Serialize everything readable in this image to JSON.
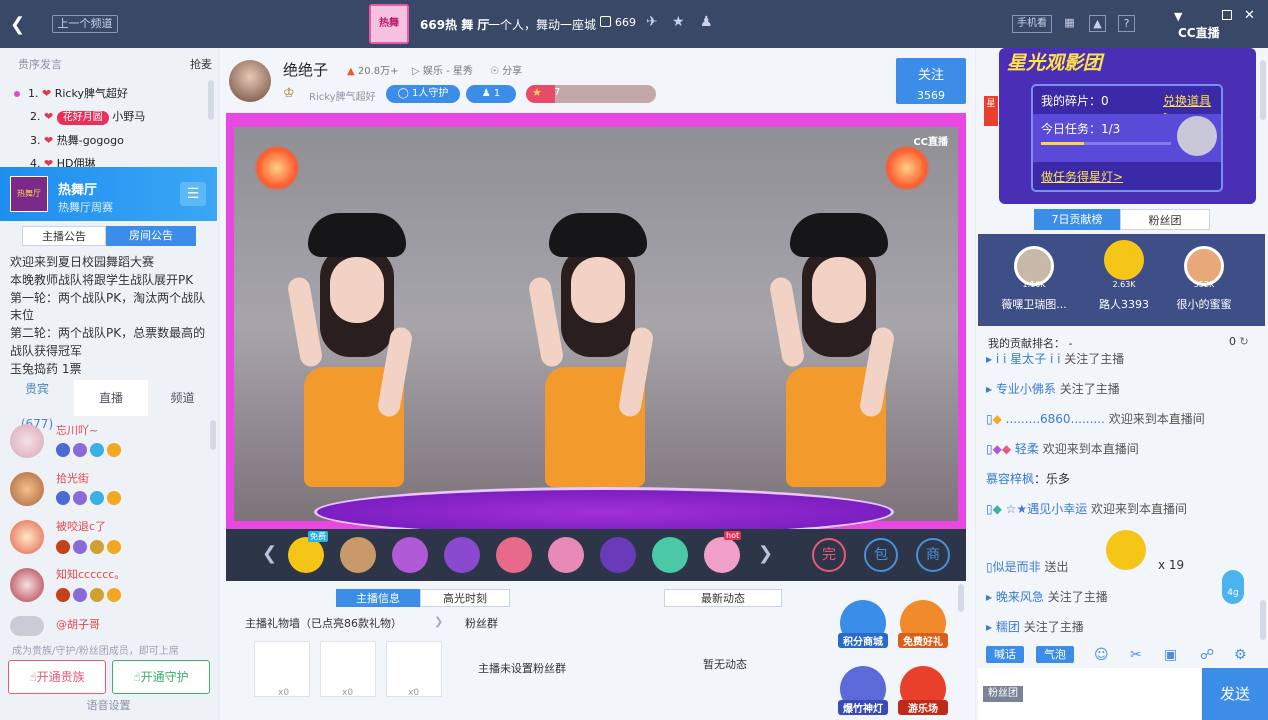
{
  "topbar": {
    "back_icon": "chevron-left-icon",
    "prev_channel": "上一个频道",
    "logo_text": "热舞",
    "title": "669热 舞 厅",
    "tagline": "一个人，舞动一座城",
    "room_id": "669",
    "phone_watch": "手机看",
    "help": "?",
    "cc_logo": "CC直播"
  },
  "left": {
    "rank_header": "贵序发言",
    "rank_action": "抢麦",
    "rank_items": [
      {
        "num": "1.",
        "name": "Ricky脾气超好"
      },
      {
        "num": "2.",
        "badge": "花好月圆",
        "name": "小野马"
      },
      {
        "num": "3.",
        "name": "热舞-gogogo"
      },
      {
        "num": "4.",
        "name": "HD佣琳"
      }
    ],
    "channel": {
      "thumb": "热舞厅",
      "name": "热舞厅",
      "sub": "热舞厅周赛"
    },
    "notice_tabs": [
      "主播公告",
      "房间公告"
    ],
    "notice_lines": [
      "欢迎来到夏日校园舞蹈大赛",
      "本晚教师战队将跟学生战队展开PK",
      "第一轮：两个战队PK，淘汰两个战队",
      "末位",
      "第二轮：两个战队PK，总票数最高的",
      "战队获得冠军",
      "玉兔捣药 1票"
    ],
    "user_tabs": [
      {
        "label": "贵宾",
        "count": "(677)"
      },
      {
        "label": "直播"
      },
      {
        "label": "频道"
      }
    ],
    "users": [
      {
        "name": "忘川吖~"
      },
      {
        "name": "拾光街"
      },
      {
        "name": "被咬退c了"
      },
      {
        "name": "知知cccccc。"
      },
      {
        "name": "@胡子哥"
      }
    ],
    "footer_hint": "成为贵族/守护/粉丝团成员，即可上席",
    "btn_noble": "开通贵族",
    "btn_guard": "开通守护",
    "voice_settings": "语音设置"
  },
  "host": {
    "name": "绝绝子",
    "heat": "20.8万+",
    "category": "娱乐 - 星秀",
    "share": "分享",
    "sub_name": "Ricky脾气超好",
    "guard": "1人守护",
    "fans": "1",
    "level": "7",
    "level_progress": 0.22,
    "follow_label": "关注",
    "follow_count": "3569"
  },
  "video": {
    "watermark": "CC直播"
  },
  "gifts": {
    "items": [
      {
        "icon": "duck-gift-icon",
        "tag": "免费",
        "color": "#f5c518"
      },
      {
        "icon": "lion-gift-icon",
        "color": "#c89a6a"
      },
      {
        "icon": "character-gift-icon",
        "color": "#b05ad8"
      },
      {
        "icon": "fairy-gift-icon",
        "color": "#8a4ad0"
      },
      {
        "icon": "cake-gift-icon",
        "color": "#e86a8a"
      },
      {
        "icon": "pony-gift-icon",
        "color": "#e88ab8"
      },
      {
        "icon": "crown-gift-icon",
        "color": "#6a3ab8"
      },
      {
        "icon": "drink-gift-icon",
        "color": "#4ac8a8"
      },
      {
        "icon": "icecream-gift-icon",
        "tag": "hot",
        "color": "#f0a0c8"
      }
    ],
    "actions": [
      "完",
      "包",
      "商"
    ]
  },
  "info": {
    "tabs": [
      "主播信息",
      "高光时刻"
    ],
    "dynamics_tab": "最新动态",
    "gift_wall": "主播礼物墙（已点亮86款礼物）",
    "fan_group": "粉丝群",
    "no_fan_group": "主播未设置粉丝群",
    "no_dynamics": "暂无动态",
    "wall_counts": [
      "x0",
      "x0",
      "x0"
    ],
    "actions": [
      {
        "label": "积分商城",
        "color": "#3a8de8"
      },
      {
        "label": "免费好礼",
        "color": "#f08a2a"
      },
      {
        "label": "爆竹神灯",
        "color": "#5a6ad8"
      },
      {
        "label": "游乐场",
        "color": "#e8402a"
      }
    ]
  },
  "promo": {
    "title": "星光观影团",
    "fragments": "我的碎片：0",
    "redeem": "兑换道具>",
    "task": "今日任务：1/3",
    "task_progress": 0.33,
    "do_task": "做任务得星灯>"
  },
  "contrib": {
    "tabs": [
      "7日贡献榜",
      "粉丝团"
    ],
    "top": [
      {
        "value": "1.10K",
        "name": "薇嘿卫瑞图..."
      },
      {
        "value": "2.63K",
        "name": "路人3393"
      },
      {
        "value": "352K",
        "name": "很小的蜜蜜"
      }
    ],
    "my_rank_label": "我的贡献排名：",
    "my_rank_value": "-",
    "my_value": "0"
  },
  "chat": {
    "lines": [
      {
        "user": " i i 星太子 i i",
        "msg": "关注了主播"
      },
      {
        "user": "专业小佛系",
        "msg": "关注了主播"
      },
      {
        "user": ".........6860.........",
        "msg": "欢迎来到本直播间"
      },
      {
        "user": "轻柔",
        "msg": "欢迎来到本直播间"
      },
      {
        "user": "慕容梓枫",
        "msg": "：乐多"
      },
      {
        "user": "☆★遇见小幸运",
        "msg": "欢迎来到本直播间"
      },
      {
        "user": "似是而非",
        "msg": "送出",
        "count": "x 19"
      },
      {
        "user": "晚来风急",
        "msg": "关注了主播"
      },
      {
        "user": "糯团",
        "msg": "关注了主播"
      }
    ],
    "drop_value": "4g",
    "btn_talk": "喊话",
    "btn_bubble": "气泡",
    "fan_tag": "粉丝团",
    "send": "发送"
  }
}
